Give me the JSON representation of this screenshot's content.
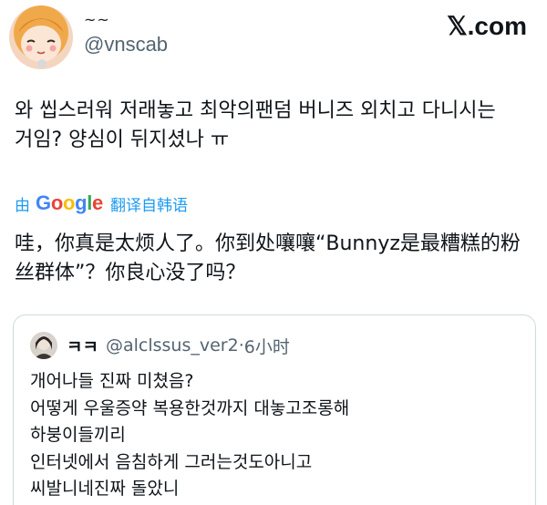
{
  "header": {
    "display_name": "~~",
    "handle": "@vnscab",
    "brand": "𝕏.com"
  },
  "tweet": {
    "text_line1": "와 씹스러워 저래놓고 최악의팬덤 버니즈 외치고 다니시는",
    "text_line2": "거임? 양심이 뒤지셨나 ㅠ"
  },
  "translation": {
    "by_label": "由",
    "google_letters": [
      "G",
      "o",
      "o",
      "g",
      "l",
      "e"
    ],
    "action_label": "翻译自韩语",
    "text_line1": "哇，你真是太烦人了。你到处嚷嚷“Bunnyz是最糟糕的粉",
    "text_line2": "丝群体”？你良心没了吗？"
  },
  "quote": {
    "name": "ㅋㅋ",
    "handle": "@alclssus_ver2",
    "separator": "·",
    "time": "6小时",
    "lines": [
      "개어나들 진짜 미쳤음?",
      "어떻게 우울증약 복용한것까지 대놓고조롱해",
      "하붕이들끼리",
      "인터넷에서 음침하게 그러는것도아니고",
      "씨발니네진짜 돌았니"
    ]
  },
  "colors": {
    "accent": "#1d9bf0",
    "text": "#0f1419",
    "muted": "#536471",
    "border": "#cfd9de"
  }
}
